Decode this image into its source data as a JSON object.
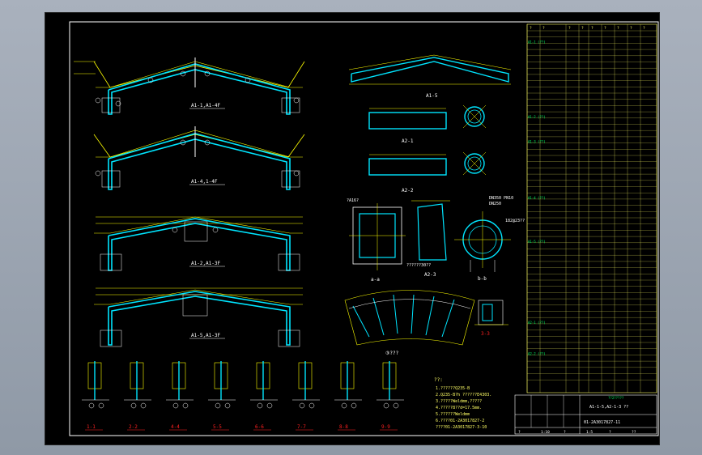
{
  "colors": {
    "background": "#000000",
    "border": "#ffffff",
    "beam": "#00e5ff",
    "dimension": "#ffff00",
    "text_white": "#ffffff",
    "text_red": "#ff2020",
    "table_lines": "#ffff66",
    "table_text": "#00ff66"
  },
  "views": {
    "frame1": "A1-1,A1-4F",
    "frame2": "A1-4,1-4F",
    "frame3": "A1-2,A1-3F",
    "frame4": "A1-5,A1-3F",
    "a15": "A1-5",
    "a21": "A2-1",
    "a22": "A2-2",
    "a23": "A2-3",
    "section_aa": "a-a",
    "section_bb": "b-b",
    "section_33": "3-3",
    "plate_view": "③???",
    "pipe_spec_1": "DN350 PN10",
    "pipe_spec_2": "DN250",
    "dim_note": "182@23??",
    "dim_ta": "?A16?",
    "a23_note": "??????30??"
  },
  "details": [
    "1-1",
    "2-2",
    "4-4",
    "5-5",
    "6-6",
    "7-7",
    "8-8",
    "9-9"
  ],
  "notes": {
    "heading": "??:",
    "lines": [
      "1.??????Q235-B",
      "2.Q235-B?h ??????E4303.",
      "3.?????Weldmm,?????",
      "4.?????8??d=17.5mm.",
      "5.??????Weldmm",
      "6.????01-2A3017827-2",
      "  ????01-2A3017827-3-10"
    ]
  },
  "title_block": {
    "title": "A1-1-5,A2-1-3 ??",
    "drawing_no": "01-2A3017827-11",
    "bottom_row": [
      "?",
      "1:10",
      "?",
      "1:5",
      "?",
      "??"
    ]
  },
  "parts_table": {
    "header": [
      "?",
      "?",
      "?",
      "?",
      "?",
      "?",
      "?",
      "?",
      "?",
      "?"
    ],
    "groups": [
      "A1-1 (??)",
      "A1-2 (??)",
      "A1-3 (??)",
      "A1-4 (??)",
      "A1-5 (??)",
      "A2-1 (??)",
      "A2-2 (??)"
    ],
    "footer": "??2?????"
  }
}
